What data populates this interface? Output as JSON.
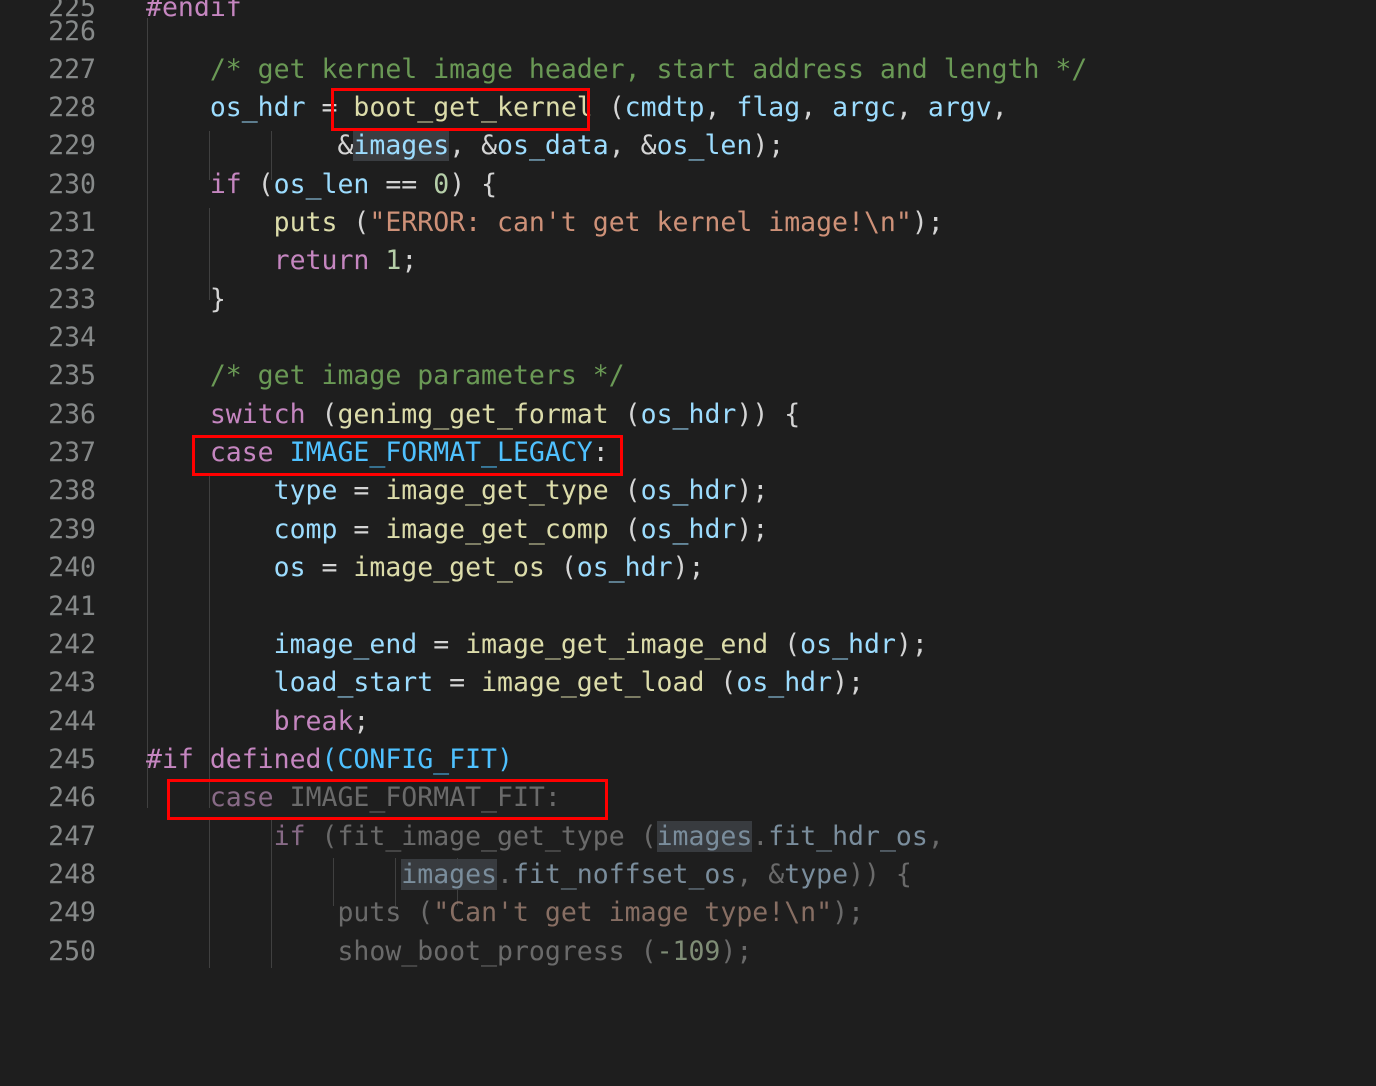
{
  "editor": {
    "background": "#1e1e1e",
    "gutter_color": "#868989",
    "annotation_color": "#FF0000",
    "first_visible_line": 225,
    "last_visible_line": 250,
    "language": "c"
  },
  "colors": {
    "comment": "#6A9955",
    "keyword": "#C586C0",
    "type": "#569CD6",
    "variable": "#9CDCFE",
    "function": "#DCDCAA",
    "string": "#CE9178",
    "number": "#B5CEA8",
    "constant": "#4FC1FF",
    "plain": "#D4D4D4",
    "occurrence_highlight": "#3A3D41",
    "indent_guide": "#404040",
    "dimmed": "#888888"
  },
  "lines": [
    {
      "num": "225",
      "text": "#endif"
    },
    {
      "num": "226",
      "text": ""
    },
    {
      "num": "227",
      "text": "    /* get kernel image header, start address and length */"
    },
    {
      "num": "228",
      "text": "    os_hdr = boot_get_kernel (cmdtp, flag, argc, argv,"
    },
    {
      "num": "229",
      "text": "            &images, &os_data, &os_len);"
    },
    {
      "num": "230",
      "text": "    if (os_len == 0) {"
    },
    {
      "num": "231",
      "text": "        puts (\"ERROR: can't get kernel image!\\n\");"
    },
    {
      "num": "232",
      "text": "        return 1;"
    },
    {
      "num": "233",
      "text": "    }"
    },
    {
      "num": "234",
      "text": ""
    },
    {
      "num": "235",
      "text": "    /* get image parameters */"
    },
    {
      "num": "236",
      "text": "    switch (genimg_get_format (os_hdr)) {"
    },
    {
      "num": "237",
      "text": "    case IMAGE_FORMAT_LEGACY:"
    },
    {
      "num": "238",
      "text": "        type = image_get_type (os_hdr);"
    },
    {
      "num": "239",
      "text": "        comp = image_get_comp (os_hdr);"
    },
    {
      "num": "240",
      "text": "        os = image_get_os (os_hdr);"
    },
    {
      "num": "241",
      "text": ""
    },
    {
      "num": "242",
      "text": "        image_end = image_get_image_end (os_hdr);"
    },
    {
      "num": "243",
      "text": "        load_start = image_get_load (os_hdr);"
    },
    {
      "num": "244",
      "text": "        break;"
    },
    {
      "num": "245",
      "text": "#if defined(CONFIG_FIT)"
    },
    {
      "num": "246",
      "text": "    case IMAGE_FORMAT_FIT:"
    },
    {
      "num": "247",
      "text": "        if (fit_image_get_type (images.fit_hdr_os,"
    },
    {
      "num": "248",
      "text": "                images.fit_noffset_os, &type)) {"
    },
    {
      "num": "249",
      "text": "            puts (\"Can't get image type!\\n\");"
    },
    {
      "num": "250",
      "text": "            show_boot_progress (-109);"
    }
  ],
  "annotations": [
    {
      "id": "box-boot-get-kernel",
      "label": "boot_get_kernel"
    },
    {
      "id": "box-case-image-format-legacy",
      "label": "case IMAGE_FORMAT_LEGACY:"
    },
    {
      "id": "box-case-image-format-fit",
      "label": "case IMAGE_FORMAT_FIT:"
    }
  ],
  "highlighted_word": "images"
}
